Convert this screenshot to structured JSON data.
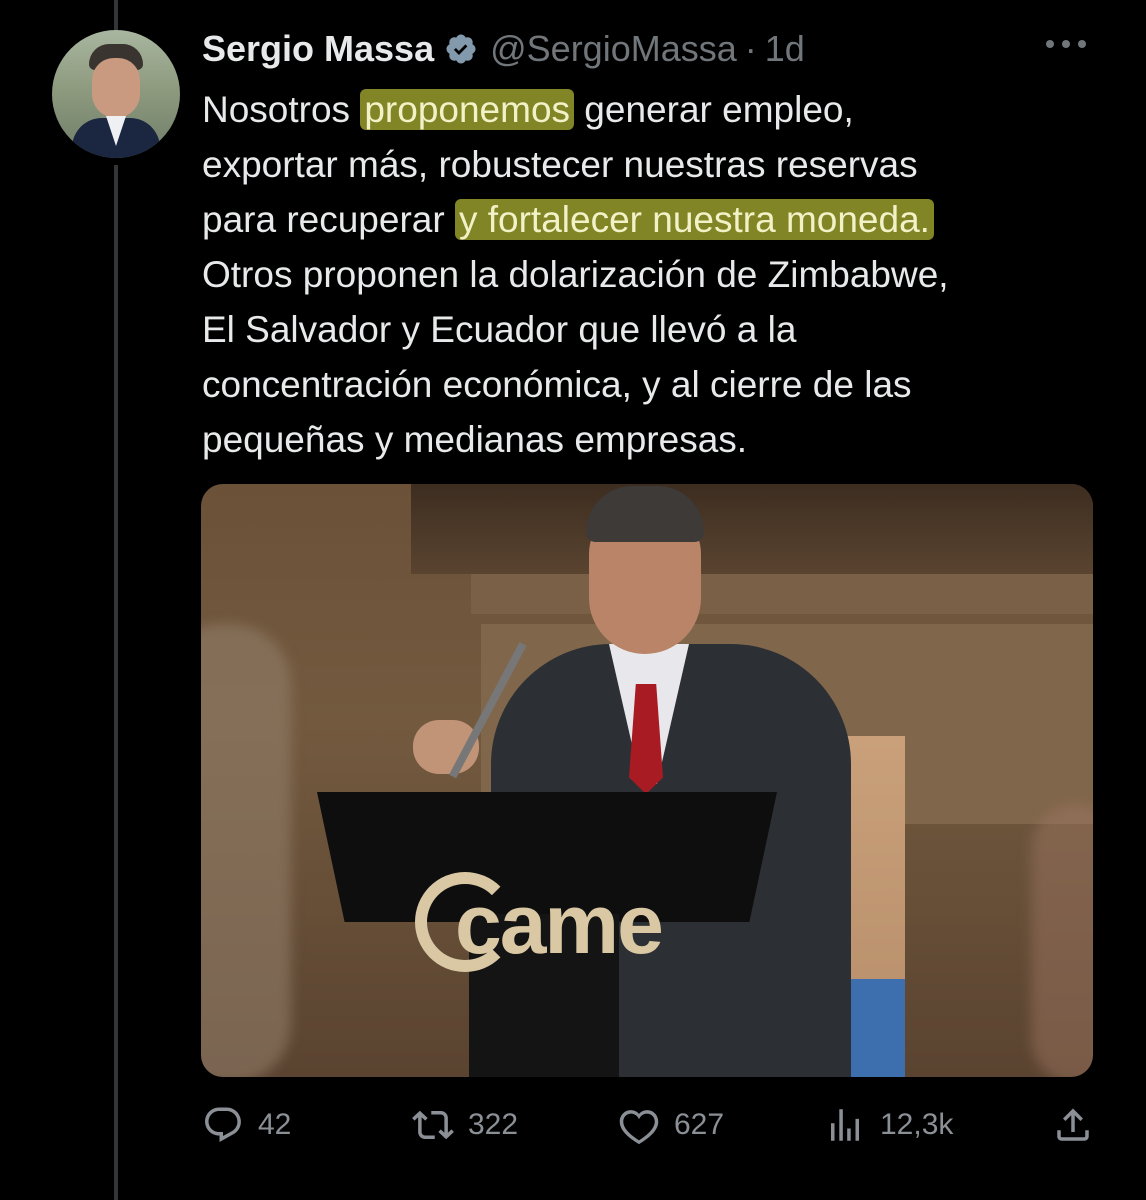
{
  "author": {
    "name": "Sergio Massa",
    "handle": "@SergioMassa",
    "separator": "·",
    "time": "1d"
  },
  "tweet": {
    "segments": [
      {
        "text": "Nosotros ",
        "highlight": false
      },
      {
        "text": "proponemos",
        "highlight": true
      },
      {
        "text": " generar empleo,\nexportar más, robustecer nuestras reservas\npara recuperar ",
        "highlight": false
      },
      {
        "text": "y fortalecer nuestra moneda.",
        "highlight": true
      },
      {
        "text": "\nOtros proponen la dolarización de Zimbabwe,\nEl Salvador y Ecuador que llevó a la\nconcentración económica, y al cierre de las\npequeñas y medianas empresas.",
        "highlight": false
      }
    ],
    "highlight_color": "#d2d73c"
  },
  "media": {
    "podium_logo": "came"
  },
  "actions": {
    "replies": "42",
    "retweets": "322",
    "likes": "627",
    "views": "12,3k"
  },
  "colors": {
    "background": "#000000",
    "text": "#e7e9ea",
    "muted": "#71767b",
    "verified": "#829aab"
  },
  "icons": [
    "verified-badge-icon",
    "more-icon",
    "reply-icon",
    "retweet-icon",
    "like-icon",
    "views-icon",
    "share-icon"
  ]
}
